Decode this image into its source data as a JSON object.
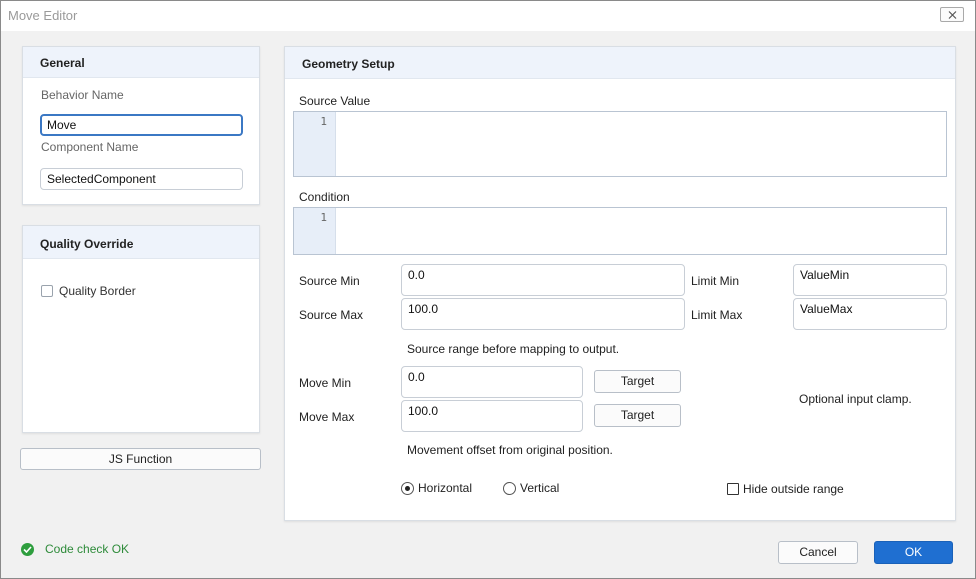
{
  "window": {
    "title": "Move Editor"
  },
  "general": {
    "header": "General",
    "behavior_name_label": "Behavior Name",
    "behavior_name_value": "Move",
    "component_name_label": "Component Name",
    "component_name_value": "SelectedComponent"
  },
  "quality": {
    "header": "Quality Override",
    "border_label": "Quality Border"
  },
  "js_function_label": "JS Function",
  "geometry": {
    "header": "Geometry Setup",
    "source_value_label": "Source Value",
    "source_value_line": "1",
    "condition_label": "Condition",
    "condition_line": "1",
    "source_min_label": "Source Min",
    "source_min_value": "0.0",
    "source_max_label": "Source Max",
    "source_max_value": "100.0",
    "limit_min_label": "Limit Min",
    "limit_min_value": "ValueMin",
    "limit_max_label": "Limit Max",
    "limit_max_value": "ValueMax",
    "source_hint": "Source range before mapping to output.",
    "move_min_label": "Move Min",
    "move_min_value": "0.0",
    "move_max_label": "Move Max",
    "move_max_value": "100.0",
    "target_label": "Target",
    "clamp_hint": "Optional input clamp.",
    "move_hint": "Movement offset from original position.",
    "horizontal_label": "Horizontal",
    "vertical_label": "Vertical",
    "orientation_selected": "Horizontal",
    "hide_outside_label": "Hide outside range"
  },
  "footer": {
    "status_text": "Code check OK",
    "cancel_label": "Cancel",
    "ok_label": "OK"
  },
  "colors": {
    "accent": "#1f6fd1",
    "status_ok": "#2e9e3e",
    "panel_header": "#eef3fb"
  }
}
